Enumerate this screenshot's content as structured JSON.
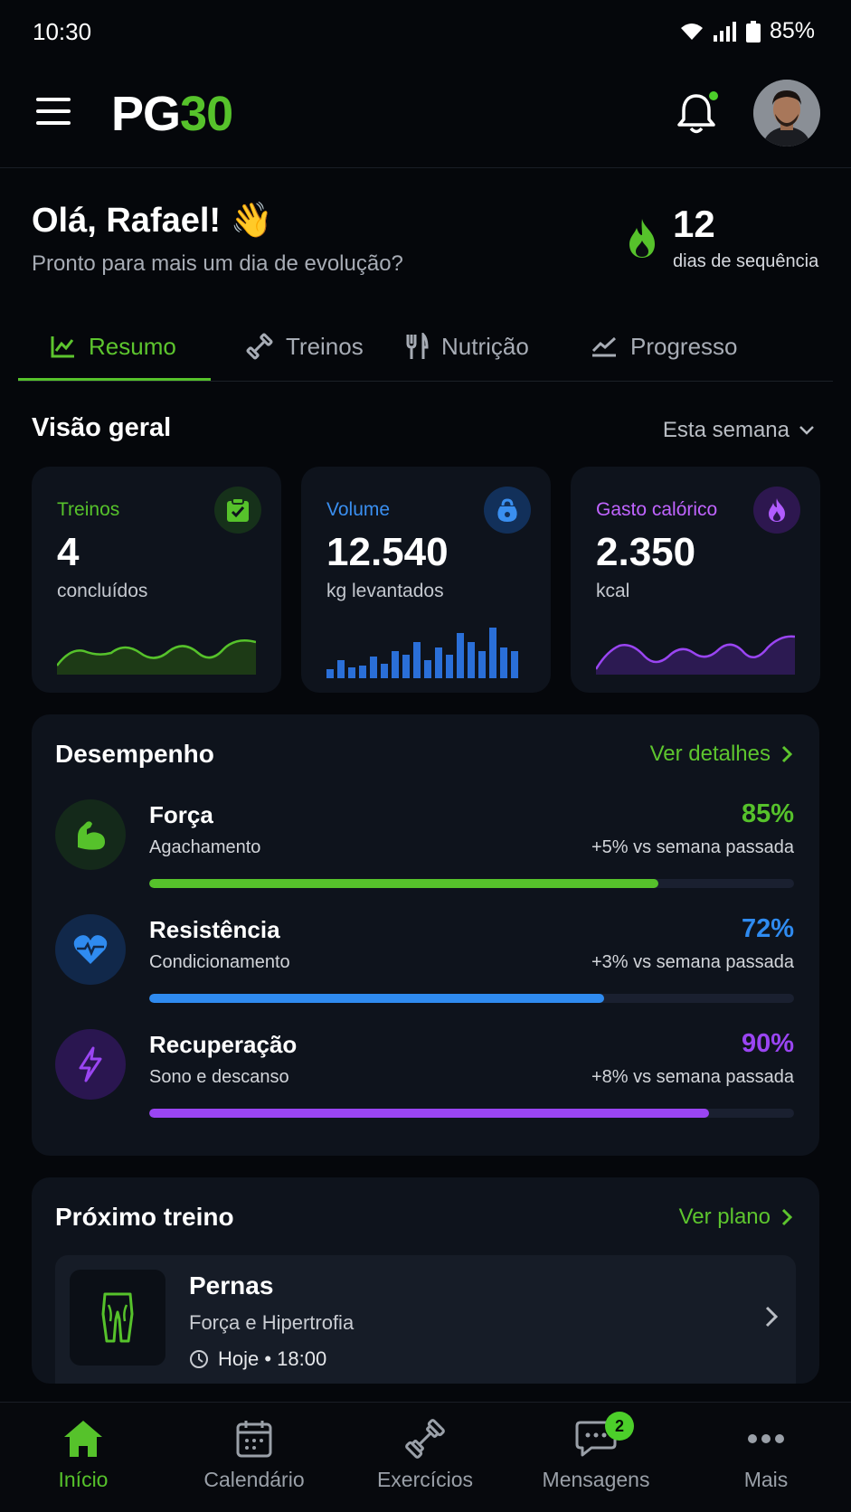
{
  "status": {
    "time": "10:30",
    "battery": "85%"
  },
  "header": {
    "logo_a": "PG",
    "logo_b": "30"
  },
  "greeting": {
    "title": "Olá, Rafael! 👋",
    "subtitle": "Pronto para mais um dia de evolução?",
    "streak_value": "12",
    "streak_label": "dias de sequência"
  },
  "tabs": [
    {
      "label": "Resumo",
      "icon": "chart-icon",
      "active": true
    },
    {
      "label": "Treinos",
      "icon": "dumbbell-icon"
    },
    {
      "label": "Nutrição",
      "icon": "utensils-icon"
    },
    {
      "label": "Progresso",
      "icon": "trend-icon"
    }
  ],
  "overview": {
    "title": "Visão geral",
    "period": "Esta semana",
    "cards": [
      {
        "label": "Treinos",
        "value": "4",
        "unit": "concluídos",
        "color": "#56c22b",
        "icon": "clipboard-check-icon"
      },
      {
        "label": "Volume",
        "value": "12.540",
        "unit": "kg levantados",
        "color": "#3a8ff0",
        "icon": "kettlebell-icon"
      },
      {
        "label": "Gasto calórico",
        "value": "2.350",
        "unit": "kcal",
        "color": "#c064ff",
        "icon": "flame-icon"
      }
    ]
  },
  "performance": {
    "title": "Desempenho",
    "link": "Ver detalhes",
    "items": [
      {
        "name": "Força",
        "sub": "Agachamento",
        "pct": "85%",
        "cmp": "+5% vs semana passada",
        "level": 0.79,
        "color": "#56c22b",
        "icon": "bicep-icon"
      },
      {
        "name": "Resistência",
        "sub": "Condicionamento",
        "pct": "72%",
        "cmp": "+3% vs semana passada",
        "level": 0.705,
        "color": "#2f8bf0",
        "icon": "heart-pulse-icon"
      },
      {
        "name": "Recuperação",
        "sub": "Sono e descanso",
        "pct": "90%",
        "cmp": "+8% vs semana passada",
        "level": 0.868,
        "color": "#9a45f2",
        "icon": "bolt-icon"
      }
    ]
  },
  "next_workout": {
    "title": "Próximo treino",
    "link": "Ver plano",
    "name": "Pernas",
    "type": "Força e Hipertrofia",
    "time": "Hoje • 18:00"
  },
  "bottom_nav": [
    {
      "label": "Início",
      "icon": "home-icon",
      "active": true
    },
    {
      "label": "Calendário",
      "icon": "calendar-icon"
    },
    {
      "label": "Exercícios",
      "icon": "dumbbell-icon"
    },
    {
      "label": "Mensagens",
      "icon": "chat-icon",
      "badge": "2"
    },
    {
      "label": "Mais",
      "icon": "more-icon"
    }
  ]
}
